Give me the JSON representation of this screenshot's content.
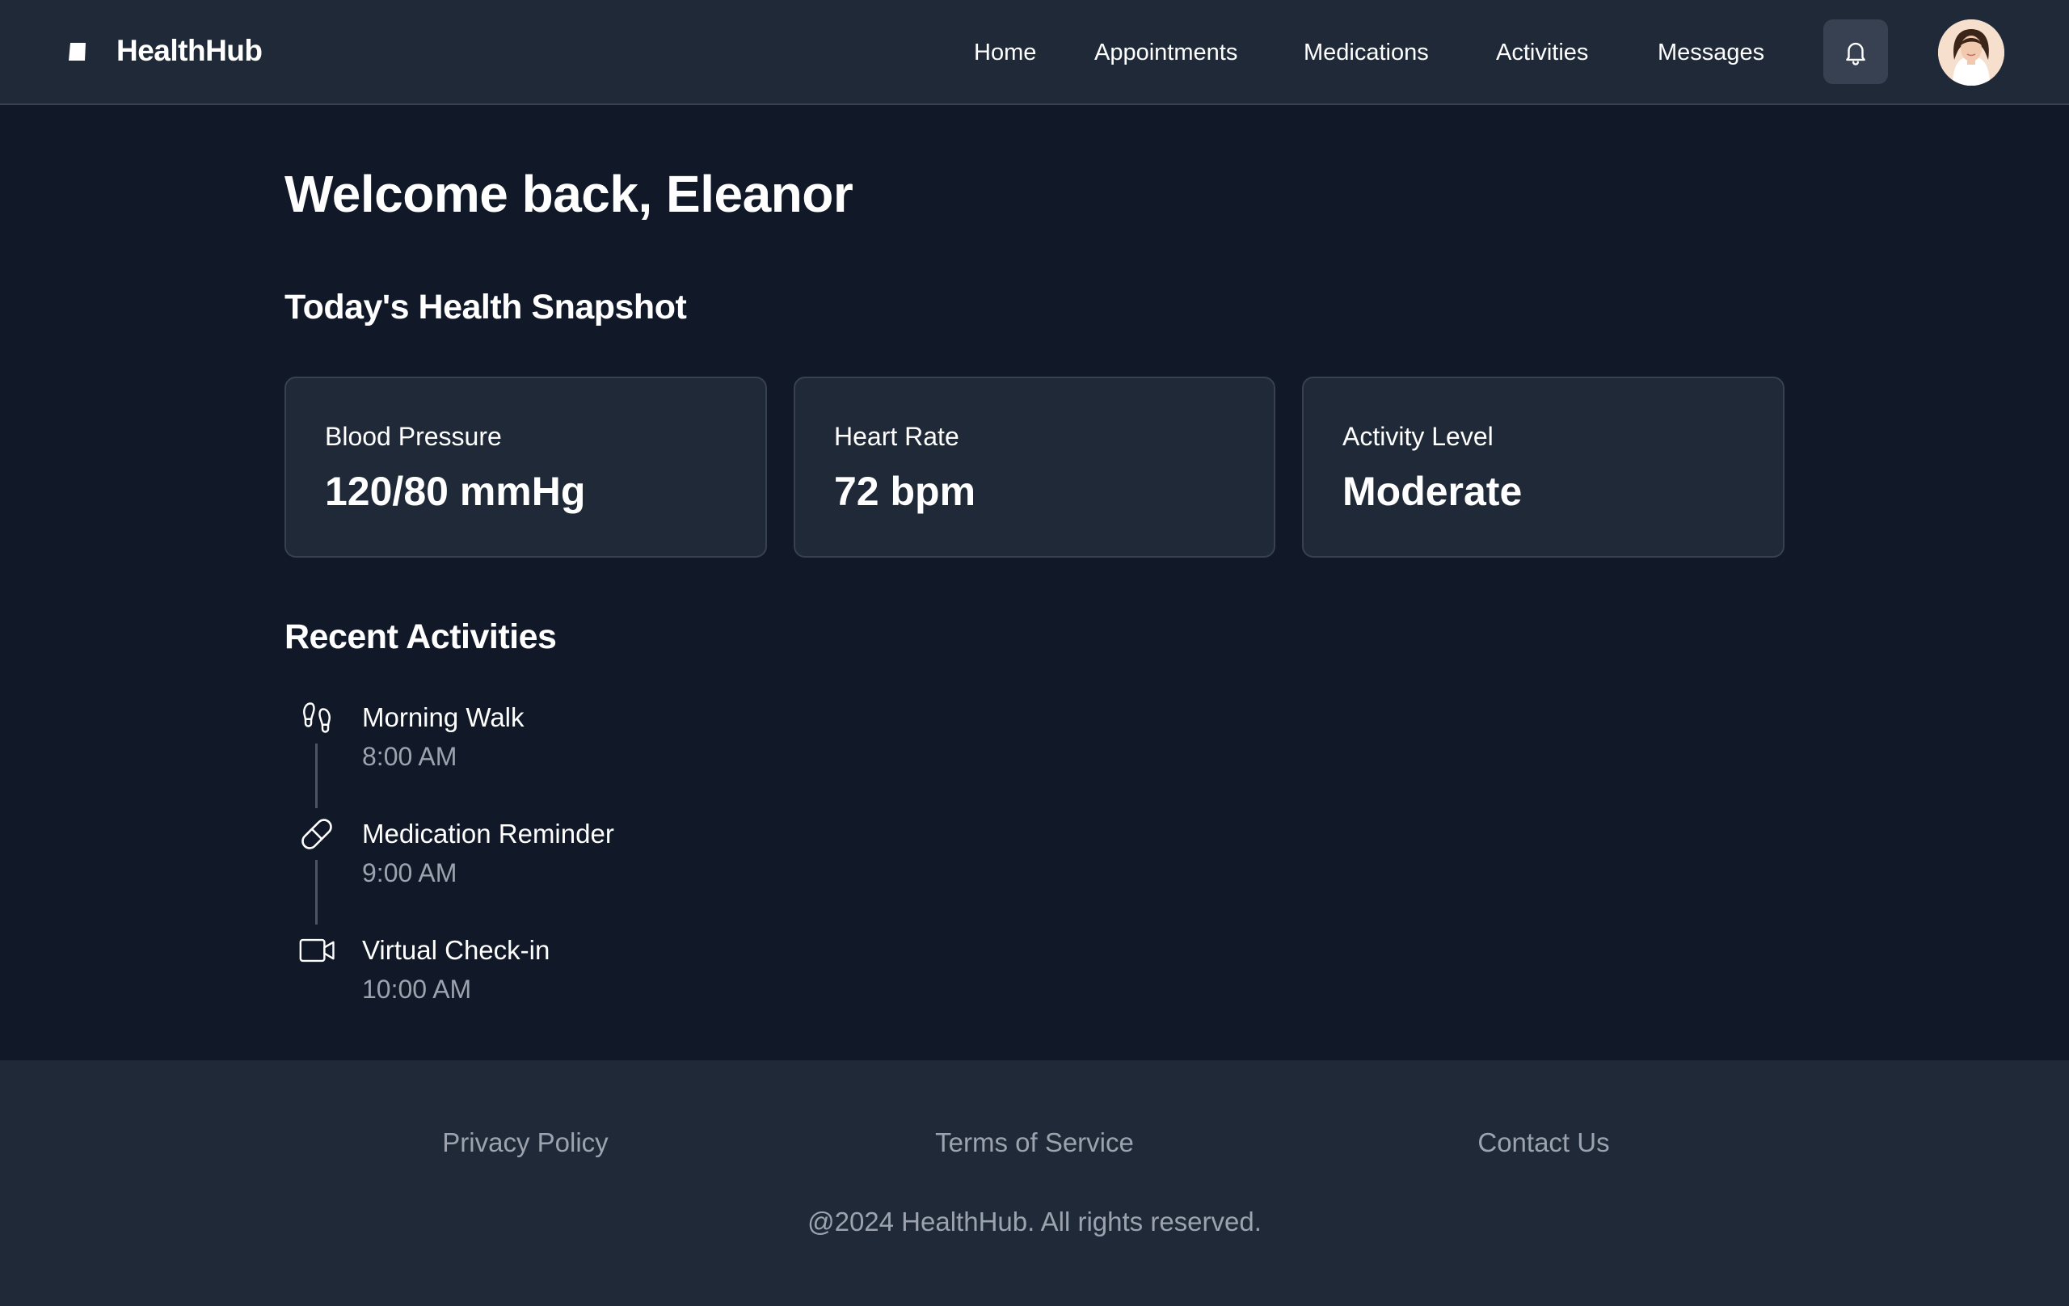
{
  "header": {
    "brand": "HealthHub",
    "nav": [
      "Home",
      "Appointments",
      "Medications",
      "Activities",
      "Messages"
    ],
    "icons": {
      "logo": "book-icon",
      "notifications": "bell-icon",
      "avatar": "user-avatar"
    }
  },
  "main": {
    "welcome": "Welcome back, Eleanor",
    "snapshot_title": "Today's Health Snapshot",
    "cards": [
      {
        "label": "Blood Pressure",
        "value": "120/80 mmHg"
      },
      {
        "label": "Heart Rate",
        "value": "72 bpm"
      },
      {
        "label": "Activity Level",
        "value": "Moderate"
      }
    ],
    "activities_title": "Recent Activities",
    "activities": [
      {
        "title": "Morning Walk",
        "time": "8:00 AM",
        "icon": "footprints-icon"
      },
      {
        "title": "Medication Reminder",
        "time": "9:00 AM",
        "icon": "pill-icon"
      },
      {
        "title": "Virtual Check-in",
        "time": "10:00 AM",
        "icon": "video-icon"
      }
    ]
  },
  "footer": {
    "links": [
      "Privacy Policy",
      "Terms of Service",
      "Contact Us"
    ],
    "copyright": "@2024 HealthHub. All rights reserved."
  },
  "colors": {
    "page_bg": "#111827",
    "surface": "#1f2937",
    "border": "#374151",
    "text": "#ffffff",
    "muted_text": "#9ca3af"
  }
}
